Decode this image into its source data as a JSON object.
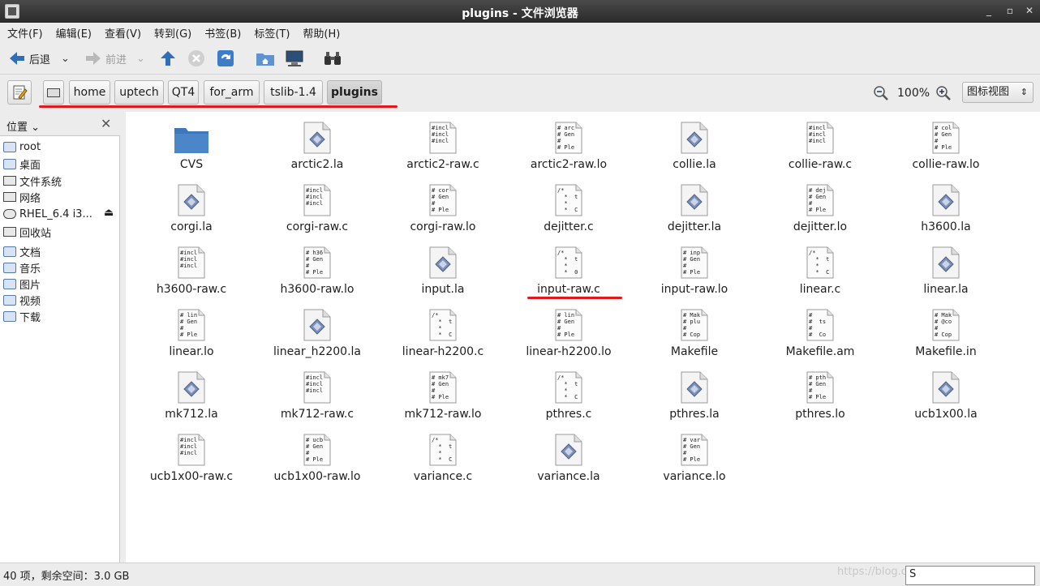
{
  "window": {
    "title": "plugins - 文件浏览器"
  },
  "menu": [
    "文件(F)",
    "编辑(E)",
    "查看(V)",
    "转到(G)",
    "书签(B)",
    "标签(T)",
    "帮助(H)"
  ],
  "toolbar": {
    "back": "后退",
    "forward": "前进"
  },
  "breadcrumb": [
    "home",
    "uptech",
    "QT4",
    "for_arm",
    "tslib-1.4",
    "plugins"
  ],
  "zoom": "100%",
  "view_mode": "图标视图",
  "sidebar": {
    "header": "位置",
    "items": [
      "root",
      "桌面",
      "文件系统",
      "网络",
      "RHEL_6.4 i3...",
      "回收站",
      "文档",
      "音乐",
      "图片",
      "视频",
      "下载"
    ]
  },
  "files": [
    {
      "name": "CVS",
      "kind": "folder",
      "preview": []
    },
    {
      "name": "arctic2.la",
      "kind": "la",
      "preview": []
    },
    {
      "name": "arctic2-raw.c",
      "kind": "text",
      "preview": [
        "#incl",
        "#incl",
        "#incl"
      ]
    },
    {
      "name": "arctic2-raw.lo",
      "kind": "text",
      "preview": [
        "# arc",
        "# Gen",
        "#",
        "# Ple"
      ]
    },
    {
      "name": "collie.la",
      "kind": "la",
      "preview": []
    },
    {
      "name": "collie-raw.c",
      "kind": "text",
      "preview": [
        "#incl",
        "#incl",
        "#incl"
      ]
    },
    {
      "name": "collie-raw.lo",
      "kind": "text",
      "preview": [
        "# col",
        "# Gen",
        "#",
        "# Ple"
      ]
    },
    {
      "name": "corgi.la",
      "kind": "la",
      "preview": []
    },
    {
      "name": "corgi-raw.c",
      "kind": "text",
      "preview": [
        "#incl",
        "#incl",
        "#incl"
      ]
    },
    {
      "name": "corgi-raw.lo",
      "kind": "text",
      "preview": [
        "# cor",
        "# Gen",
        "#",
        "# Ple"
      ]
    },
    {
      "name": "dejitter.c",
      "kind": "text",
      "preview": [
        "/*",
        "  *  t",
        "  *",
        "  *  C"
      ]
    },
    {
      "name": "dejitter.la",
      "kind": "la",
      "preview": []
    },
    {
      "name": "dejitter.lo",
      "kind": "text",
      "preview": [
        "# dej",
        "# Gen",
        "#",
        "# Ple"
      ]
    },
    {
      "name": "h3600.la",
      "kind": "la",
      "preview": []
    },
    {
      "name": "h3600-raw.c",
      "kind": "text",
      "preview": [
        "#incl",
        "#incl",
        "#incl"
      ]
    },
    {
      "name": "h3600-raw.lo",
      "kind": "text",
      "preview": [
        "# h36",
        "# Gen",
        "#",
        "# Ple"
      ]
    },
    {
      "name": "input.la",
      "kind": "la",
      "preview": []
    },
    {
      "name": "input-raw.c",
      "kind": "text",
      "preview": [
        "/*",
        "  *  t",
        "  *",
        "  *  0"
      ]
    },
    {
      "name": "input-raw.lo",
      "kind": "text",
      "preview": [
        "# inp",
        "# Gen",
        "#",
        "# Ple"
      ]
    },
    {
      "name": "linear.c",
      "kind": "text",
      "preview": [
        "/*",
        "  *  t",
        "  *",
        "  *  C"
      ]
    },
    {
      "name": "linear.la",
      "kind": "la",
      "preview": []
    },
    {
      "name": "linear.lo",
      "kind": "text",
      "preview": [
        "# lin",
        "# Gen",
        "#",
        "# Ple"
      ]
    },
    {
      "name": "linear_h2200.la",
      "kind": "la",
      "preview": []
    },
    {
      "name": "linear-h2200.c",
      "kind": "text",
      "preview": [
        "/*",
        "  *  t",
        "  *",
        "  *  C"
      ]
    },
    {
      "name": "linear-h2200.lo",
      "kind": "text",
      "preview": [
        "# lin",
        "# Gen",
        "#",
        "# Ple"
      ]
    },
    {
      "name": "Makefile",
      "kind": "text",
      "preview": [
        "# Mak",
        "# plu",
        "#",
        "# Cop"
      ]
    },
    {
      "name": "Makefile.am",
      "kind": "text",
      "preview": [
        "#",
        "#  ts",
        "#",
        "#  Co"
      ]
    },
    {
      "name": "Makefile.in",
      "kind": "text",
      "preview": [
        "# Mak",
        "# @co",
        "#",
        "# Cop"
      ]
    },
    {
      "name": "mk712.la",
      "kind": "la",
      "preview": []
    },
    {
      "name": "mk712-raw.c",
      "kind": "text",
      "preview": [
        "#incl",
        "#incl",
        "#incl"
      ]
    },
    {
      "name": "mk712-raw.lo",
      "kind": "text",
      "preview": [
        "# mk7",
        "# Gen",
        "#",
        "# Ple"
      ]
    },
    {
      "name": "pthres.c",
      "kind": "text",
      "preview": [
        "/*",
        "  *  t",
        "  *",
        "  *  C"
      ]
    },
    {
      "name": "pthres.la",
      "kind": "la",
      "preview": []
    },
    {
      "name": "pthres.lo",
      "kind": "text",
      "preview": [
        "# pth",
        "# Gen",
        "#",
        "# Ple"
      ]
    },
    {
      "name": "ucb1x00.la",
      "kind": "la",
      "preview": []
    },
    {
      "name": "ucb1x00-raw.c",
      "kind": "text",
      "preview": [
        "#incl",
        "#incl",
        "#incl"
      ]
    },
    {
      "name": "ucb1x00-raw.lo",
      "kind": "text",
      "preview": [
        "# ucb",
        "# Gen",
        "#",
        "# Ple"
      ]
    },
    {
      "name": "variance.c",
      "kind": "text",
      "preview": [
        "/*",
        "  *  t",
        "  *",
        "  *  C"
      ]
    },
    {
      "name": "variance.la",
      "kind": "la",
      "preview": []
    },
    {
      "name": "variance.lo",
      "kind": "text",
      "preview": [
        "# var",
        "# Gen",
        "#",
        "# Ple"
      ]
    }
  ],
  "status": {
    "text": "40 项，剩余空间：3.0 GB",
    "search_value": "S",
    "watermark": "https://blog.csdn.net/Lazy_Goat"
  },
  "colors": {
    "accent_red": "#e0191c",
    "folder_blue": "#4a86c8"
  }
}
